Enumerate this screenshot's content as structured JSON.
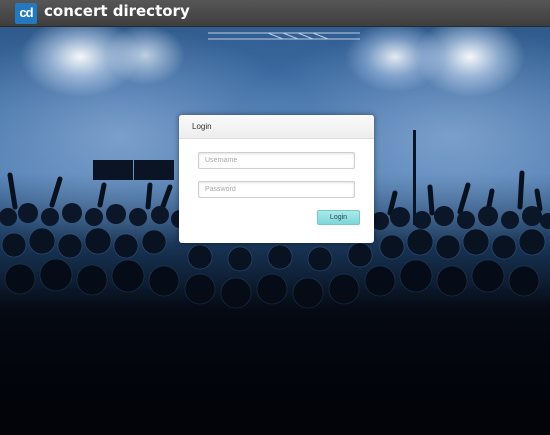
{
  "header": {
    "logo_text": "cd",
    "brand": "concert directory"
  },
  "login": {
    "title": "Login",
    "username_placeholder": "Username",
    "password_placeholder": "Password",
    "button_label": "Login"
  },
  "colors": {
    "brand_blue": "#2479be",
    "button_teal": "#7ed6d9",
    "header_bg": "#4a4a4a"
  }
}
